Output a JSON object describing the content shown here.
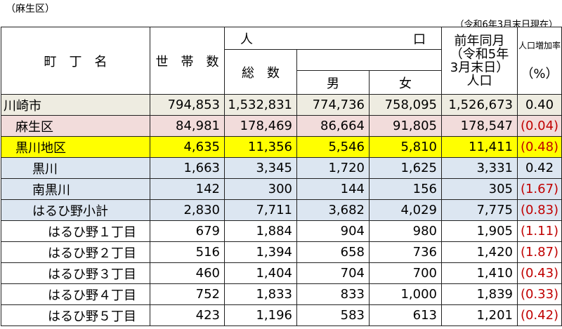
{
  "header": {
    "ward_tag": "（麻生区）",
    "as_of": "（令和6年3月末日現在）",
    "col_name": "町　丁　名",
    "col_households": "世　帯　数",
    "col_pop_left": "人",
    "col_pop_right": "口",
    "col_total": "総　数",
    "col_male": "男",
    "col_female": "女",
    "col_prev_line1": "前年同月",
    "col_prev_line2": "（令和5年",
    "col_prev_line3": "3月末日）",
    "col_prev_line4": "人口",
    "col_rate_title": "人口増加率",
    "col_rate_unit": "（%）"
  },
  "rows": [
    {
      "name": "川崎市",
      "level": "city",
      "households": "794,853",
      "total": "1,532,831",
      "male": "774,736",
      "female": "758,095",
      "prev": "1,526,673",
      "rate": "0.40",
      "negative": false
    },
    {
      "name": "麻生区",
      "level": "ward",
      "households": "84,981",
      "total": "178,469",
      "male": "86,664",
      "female": "91,805",
      "prev": "178,547",
      "rate": "(0.04)",
      "negative": true
    },
    {
      "name": "黒川地区",
      "level": "district",
      "households": "4,635",
      "total": "11,356",
      "male": "5,546",
      "female": "5,810",
      "prev": "11,411",
      "rate": "(0.48)",
      "negative": true
    },
    {
      "name": "黒川",
      "level": "town",
      "households": "1,663",
      "total": "3,345",
      "male": "1,720",
      "female": "1,625",
      "prev": "3,331",
      "rate": "0.42",
      "negative": false
    },
    {
      "name": "南黒川",
      "level": "town",
      "households": "142",
      "total": "300",
      "male": "144",
      "female": "156",
      "prev": "305",
      "rate": "(1.67)",
      "negative": true
    },
    {
      "name": "はるひ野小計",
      "level": "town",
      "households": "2,830",
      "total": "7,711",
      "male": "3,682",
      "female": "4,029",
      "prev": "7,775",
      "rate": "(0.83)",
      "negative": true
    },
    {
      "name": "はるひ野１丁目",
      "level": "chome",
      "households": "679",
      "total": "1,884",
      "male": "904",
      "female": "980",
      "prev": "1,905",
      "rate": "(1.11)",
      "negative": true
    },
    {
      "name": "はるひ野２丁目",
      "level": "chome",
      "households": "516",
      "total": "1,394",
      "male": "658",
      "female": "736",
      "prev": "1,420",
      "rate": "(1.87)",
      "negative": true
    },
    {
      "name": "はるひ野３丁目",
      "level": "chome",
      "households": "460",
      "total": "1,404",
      "male": "704",
      "female": "700",
      "prev": "1,410",
      "rate": "(0.43)",
      "negative": true
    },
    {
      "name": "はるひ野４丁目",
      "level": "chome",
      "households": "752",
      "total": "1,833",
      "male": "833",
      "female": "1,000",
      "prev": "1,839",
      "rate": "(0.33)",
      "negative": true
    },
    {
      "name": "はるひ野５丁目",
      "level": "chome",
      "households": "423",
      "total": "1,196",
      "male": "583",
      "female": "613",
      "prev": "1,201",
      "rate": "(0.42)",
      "negative": true
    }
  ],
  "colors": {
    "city_bg": "#eeece1",
    "ward_bg": "#f2dcdb",
    "district_bg": "#ffff00",
    "town_bg": "#dce6f1",
    "negative_text": "#c00000"
  }
}
